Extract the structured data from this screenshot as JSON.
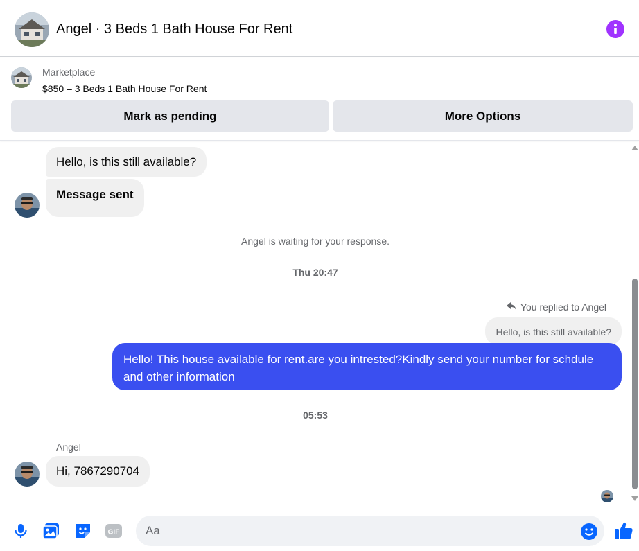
{
  "header": {
    "title": "Angel · 3 Beds 1 Bath House For Rent",
    "info_icon": "info-icon"
  },
  "marketplace": {
    "label": "Marketplace",
    "item": "$850 – 3 Beds 1 Bath House For Rent",
    "pending_button": "Mark as pending",
    "more_button": "More Options"
  },
  "messages": {
    "incoming_1": "Hello, is this still available?",
    "incoming_2": "Message sent",
    "system_notice": "Angel is waiting for your response.",
    "timestamp_1": "Thu 20:47",
    "replied_label": "You replied to Angel",
    "quoted_text": "Hello, is this still available?",
    "outgoing_1": "Hello! This house available for rent.are you intrested?Kindly send your number for schdule and other information",
    "timestamp_2": "05:53",
    "sender_name": "Angel",
    "incoming_3": "Hi, 7867290704"
  },
  "composer": {
    "placeholder": "Aa",
    "icons": [
      "microphone-icon",
      "photo-icon",
      "sticker-icon",
      "gif-icon",
      "emoji-icon",
      "thumbs-up-icon"
    ]
  },
  "colors": {
    "accent": "#0866ff",
    "outgoing_bubble": "#3a4ff0",
    "info_purple": "#a033ff",
    "bubble_gray": "#f0f0f0"
  }
}
